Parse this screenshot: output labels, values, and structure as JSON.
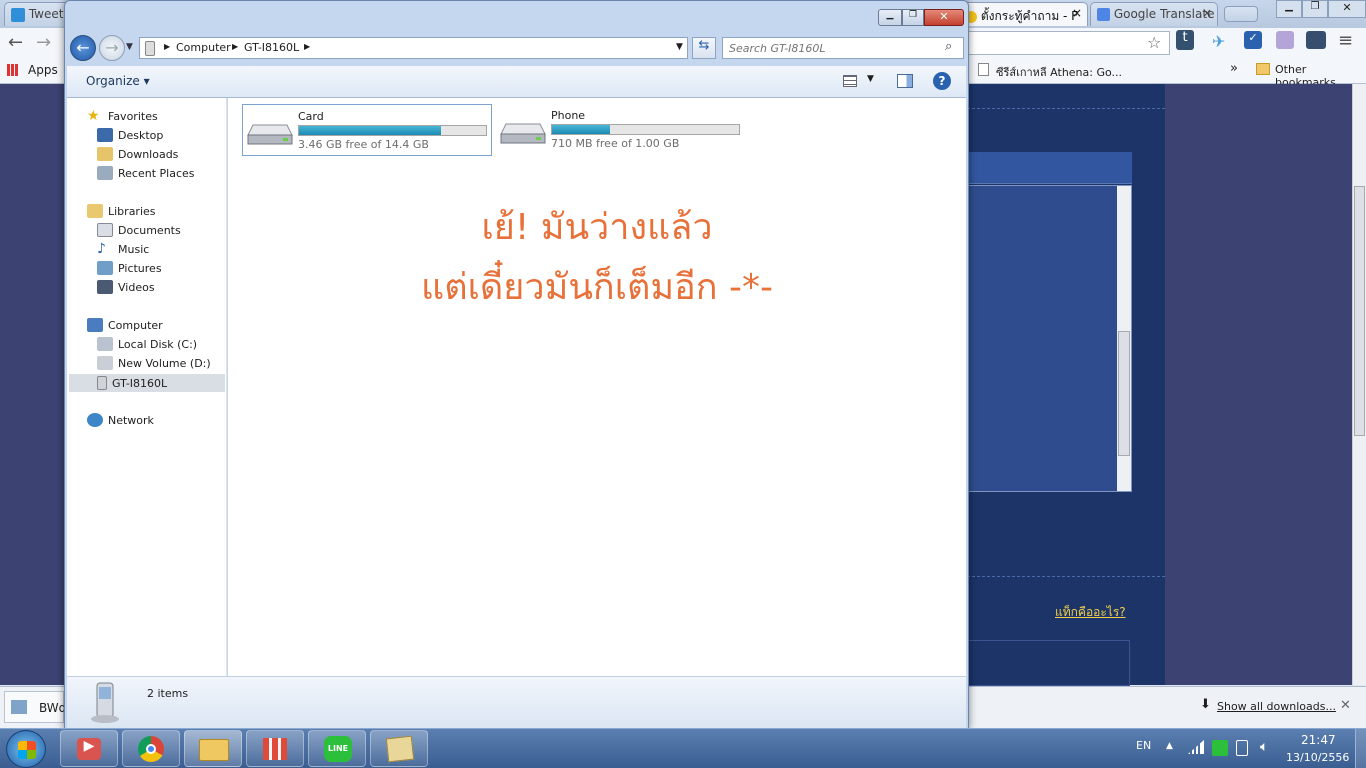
{
  "chrome": {
    "tabs": [
      {
        "label": "Tweet"
      },
      {
        "label": ""
      },
      {
        "label": ""
      },
      {
        "label": ""
      },
      {
        "label": ""
      },
      {
        "label": ""
      },
      {
        "label": ""
      },
      {
        "label": "ตั้งกระทู้คำถาม - F"
      },
      {
        "label": "Google Translate"
      }
    ],
    "bookmarks": {
      "apps_label": "Apps",
      "item_label": "ซีรีส์เกาหลี Athena: Go...",
      "overflow": "»",
      "other_label": "Other bookmarks"
    },
    "page_link": "แท็กคืออะไร?",
    "downloads": {
      "item_label": "BWd",
      "show_all": "Show all downloads..."
    }
  },
  "explorer": {
    "breadcrumb": [
      "Computer",
      "GT-I8160L"
    ],
    "search_placeholder": "Search GT-I8160L",
    "organize_label": "Organize",
    "nav": {
      "favorites": "Favorites",
      "desktop": "Desktop",
      "downloads": "Downloads",
      "recent": "Recent Places",
      "libraries": "Libraries",
      "documents": "Documents",
      "music": "Music",
      "pictures": "Pictures",
      "videos": "Videos",
      "computer": "Computer",
      "local_disk": "Local Disk (C:)",
      "new_volume": "New Volume (D:)",
      "device": "GT-I8160L",
      "network": "Network"
    },
    "drives": [
      {
        "name": "Card",
        "free_text": "3.46 GB free of 14.4 GB",
        "used_fraction": 0.76
      },
      {
        "name": "Phone",
        "free_text": "710 MB free of 1.00 GB",
        "used_fraction": 0.31
      }
    ],
    "annotation_line1": "เย้! มันว่างแล้ว",
    "annotation_line2": "แต่เดี๋ยวมันก็เต็มอีก -*-",
    "status_count": "2 items"
  },
  "taskbar": {
    "language": "EN",
    "time": "21:47",
    "date": "13/10/2556"
  },
  "colors": {
    "accent_orange": "#e8713a",
    "bar_fill": "#1c8bb3",
    "page_blue": "#1c3468"
  }
}
